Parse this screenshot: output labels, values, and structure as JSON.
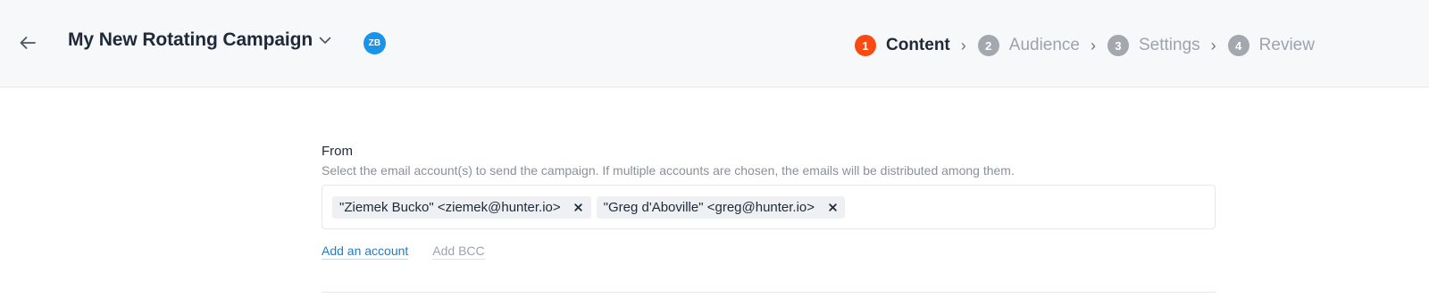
{
  "header": {
    "back_icon": "arrow-left-icon",
    "campaign_title": "My New Rotating Campaign",
    "title_dropdown_icon": "chevron-down-icon",
    "avatar_initials": "ZB",
    "avatar_color": "#1994e8"
  },
  "stepper": {
    "active_color": "#fa4a14",
    "inactive_color": "#a3a7ae",
    "separator": "›",
    "steps": [
      {
        "number": "1",
        "label": "Content",
        "active": true
      },
      {
        "number": "2",
        "label": "Audience",
        "active": false
      },
      {
        "number": "3",
        "label": "Settings",
        "active": false
      },
      {
        "number": "4",
        "label": "Review",
        "active": false
      }
    ]
  },
  "from": {
    "label": "From",
    "help_text": "Select the email account(s) to send the campaign. If multiple accounts are chosen, the emails will be distributed among them.",
    "selected_accounts": [
      {
        "text": "\"Ziemek Bucko\" <ziemek@hunter.io>",
        "remove_icon": "close-icon"
      },
      {
        "text": "\"Greg d'Aboville\" <greg@hunter.io>",
        "remove_icon": "close-icon"
      }
    ],
    "add_account_label": "Add an account",
    "add_bcc_label": "Add BCC",
    "link_color": "#1a7fd0"
  }
}
